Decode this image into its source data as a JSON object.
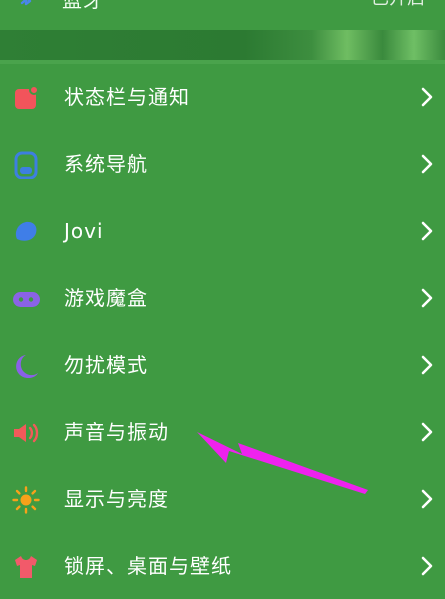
{
  "top": {
    "label": "蓝牙",
    "status": "已开启"
  },
  "settings": {
    "items": [
      {
        "label": "状态栏与通知",
        "icon": "notification-icon",
        "color": "#f2545b"
      },
      {
        "label": "系统导航",
        "icon": "navigation-icon",
        "color": "#3d7fe0"
      },
      {
        "label": "Jovi",
        "icon": "jovi-icon",
        "color": "#3f7ee8"
      },
      {
        "label": "游戏魔盒",
        "icon": "gamepad-icon",
        "color": "#8a63e6"
      },
      {
        "label": "勿扰模式",
        "icon": "moon-icon",
        "color": "#8a60e8"
      },
      {
        "label": "声音与振动",
        "icon": "speaker-icon",
        "color": "#f25a5a"
      },
      {
        "label": "显示与亮度",
        "icon": "sun-icon",
        "color": "#f7a11a"
      },
      {
        "label": "锁屏、桌面与壁纸",
        "icon": "shirt-icon",
        "color": "#f25a6a"
      }
    ]
  },
  "annotation": {
    "arrow_color": "#ee22ee"
  }
}
